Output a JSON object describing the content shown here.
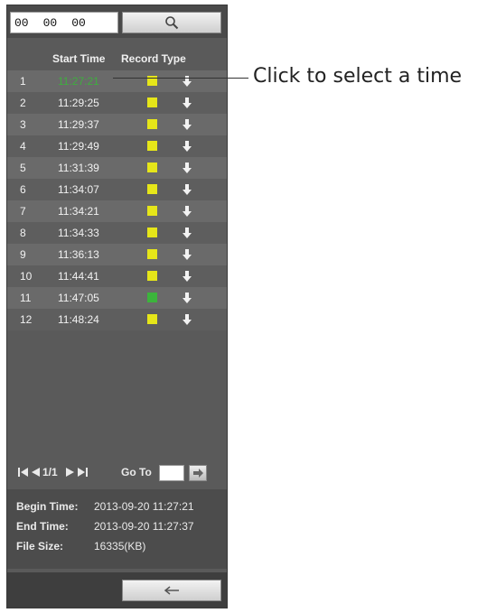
{
  "time_input": {
    "hh": "00",
    "mm": "00",
    "ss": "00"
  },
  "header": {
    "start_time": "Start Time",
    "record_type": "Record Type"
  },
  "records": [
    {
      "num": "1",
      "time": "11:27:21",
      "color": "#e6e619",
      "selected": true
    },
    {
      "num": "2",
      "time": "11:29:25",
      "color": "#e6e619"
    },
    {
      "num": "3",
      "time": "11:29:37",
      "color": "#e6e619"
    },
    {
      "num": "4",
      "time": "11:29:49",
      "color": "#e6e619"
    },
    {
      "num": "5",
      "time": "11:31:39",
      "color": "#e6e619"
    },
    {
      "num": "6",
      "time": "11:34:07",
      "color": "#e6e619"
    },
    {
      "num": "7",
      "time": "11:34:21",
      "color": "#e6e619"
    },
    {
      "num": "8",
      "time": "11:34:33",
      "color": "#e6e619"
    },
    {
      "num": "9",
      "time": "11:36:13",
      "color": "#e6e619"
    },
    {
      "num": "10",
      "time": "11:44:41",
      "color": "#e6e619"
    },
    {
      "num": "11",
      "time": "11:47:05",
      "color": "#3cb43c"
    },
    {
      "num": "12",
      "time": "11:48:24",
      "color": "#e6e619"
    }
  ],
  "pager": {
    "page": "1/1",
    "goto_label": "Go To"
  },
  "info": {
    "begin_label": "Begin Time:",
    "begin_value": "2013-09-20 11:27:21",
    "end_label": "End Time:",
    "end_value": "2013-09-20 11:27:37",
    "size_label": "File Size:",
    "size_value": "16335(KB)"
  },
  "callout": "Click to select a time"
}
